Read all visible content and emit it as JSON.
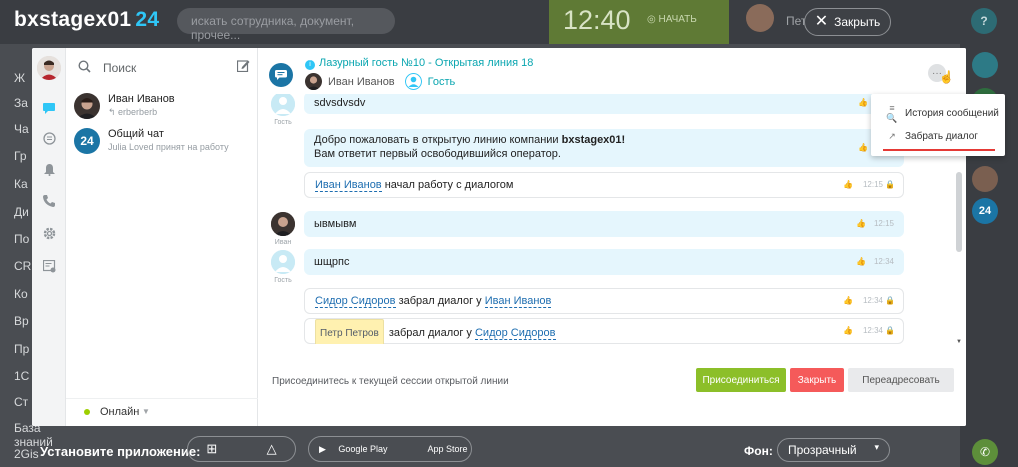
{
  "portal": {
    "brand_name": "bxstagex01",
    "brand_number": "24",
    "search_placeholder": "искать сотрудника, документ, прочее...",
    "clock_time": "12:40",
    "clock_start": "НАЧАТЬ",
    "user_name": "Петр П",
    "close_label": "Закрыть",
    "help_label": "?",
    "left_menu": [
      "Ж",
      "За",
      "Ча",
      "Гр",
      "Ка",
      "Ди",
      "По",
      "CR",
      "Ко",
      "Вр",
      "Пр",
      "1С",
      "Ст",
      "База знаний",
      "2Gis"
    ],
    "install_label": "Установите приложение:",
    "google_play": "Google Play",
    "app_store": "App Store",
    "background_label": "Фон:",
    "background_value": "Прозрачный",
    "rightbar_badge": "24"
  },
  "sidebar": {
    "search_placeholder": "Поиск",
    "recent": [
      {
        "title": "Иван Иванов",
        "subtitle": "erberberb"
      },
      {
        "title": "Общий чат",
        "subtitle": "Julia Loved принят на работу",
        "badge": "24"
      }
    ],
    "status": "Онлайн"
  },
  "chat": {
    "title": "Лазурный гость №10 - Открытая линия 18",
    "participants": [
      "Иван Иванов",
      "Гость"
    ],
    "messages": {
      "m1": {
        "text": "sdvsdvsdv",
        "author_label": "Гость"
      },
      "m2": {
        "line1_prefix": "Добро пожаловать в открытую линию компании ",
        "company": "bxstagex01!",
        "line2": "Вам ответит первый освободившийся оператор."
      },
      "m3": {
        "user": "Иван Иванов",
        "action": " начал работу с диалогом",
        "time": "12:15"
      },
      "m4": {
        "text": "ывмывм",
        "author_label": "Иван",
        "time": "12:15"
      },
      "m5": {
        "text": "шщрпс",
        "author_label": "Гость",
        "time": "12:34"
      },
      "m6": {
        "user1": "Сидор Сидоров",
        "action": " забрал диалог у ",
        "user2": "Иван Иванов",
        "time": "12:34"
      },
      "m7": {
        "user1": "Петр Петров",
        "action": " забрал диалог у ",
        "user2": "Сидор Сидоров",
        "time": "12:34"
      }
    },
    "join_text": "Присоединитесь к текущей сессии открытой линии",
    "btn_join": "Присоединиться",
    "btn_close": "Закрыть",
    "btn_forward": "Переадресовать"
  },
  "menu": {
    "history": "История сообщений",
    "take": "Забрать диалог"
  },
  "colors": {
    "accent": "#2fc6f6",
    "join_green": "#8cbf29",
    "close_red": "#f55a5a",
    "guest_bubble": "#e5f6fd",
    "underline_red": "#e53935"
  }
}
